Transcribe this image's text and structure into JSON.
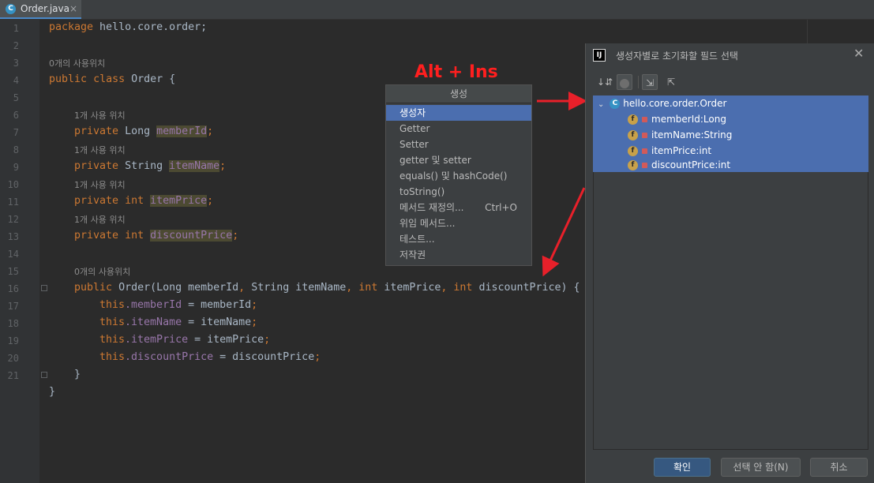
{
  "tab": {
    "file_name": "Order.java",
    "close": "×",
    "icon_letter": "C"
  },
  "editor": {
    "line_numbers": [
      "1",
      "2",
      "3",
      "4",
      "5",
      "6",
      "7",
      "8",
      "9",
      "10",
      "11",
      "12",
      "13",
      "14",
      "15",
      "16",
      "17",
      "18",
      "19",
      "20",
      "21"
    ],
    "line1": {
      "kw": "package",
      "rest": " hello.core.order;"
    },
    "hint_class": "0개의 사용위치",
    "line3": {
      "kw1": "public",
      "kw2": "class",
      "name": "Order",
      "brace": " {"
    },
    "hint_member": "1개 사용 위치",
    "fields": [
      {
        "kw": "private",
        "type": "Long",
        "name": "memberId"
      },
      {
        "kw": "private",
        "type": "String",
        "name": "itemName"
      },
      {
        "kw": "private",
        "type": "int",
        "name": "itemPrice"
      },
      {
        "kw": "private",
        "type": "int",
        "name": "discountPrice"
      }
    ],
    "hint_ctor": "0개의 사용위치",
    "ctor": {
      "kw": "public",
      "name": "Order",
      "p1": "(Long memberId",
      "c1": ",",
      "p2": " String itemName",
      "c2": ",",
      "t3": " int",
      "p3": " itemPrice",
      "c3": ",",
      "t4": " int",
      "p4": " discountPrice) {"
    },
    "assignments": [
      {
        "this": "this",
        "field": ".memberId",
        "rest": " = memberId",
        "semi": ";"
      },
      {
        "this": "this",
        "field": ".itemName",
        "rest": " = itemName",
        "semi": ";"
      },
      {
        "this": "this",
        "field": ".itemPrice",
        "rest": " = itemPrice",
        "semi": ";"
      },
      {
        "this": "this",
        "field": ".discountPrice",
        "rest": " = discountPrice",
        "semi": ";"
      }
    ],
    "close_inner": "}",
    "close_outer": "}",
    "semi": ";"
  },
  "annotation": "Alt + Ins",
  "generate_popup": {
    "title": "생성",
    "items": [
      {
        "label": "생성자",
        "shortcut": ""
      },
      {
        "label": "Getter",
        "shortcut": ""
      },
      {
        "label": "Setter",
        "shortcut": ""
      },
      {
        "label": "getter 및 setter",
        "shortcut": ""
      },
      {
        "label": "equals() 및 hashCode()",
        "shortcut": ""
      },
      {
        "label": "toString()",
        "shortcut": ""
      },
      {
        "label": "메서드 재정의...",
        "shortcut": "Ctrl+O"
      },
      {
        "label": "위임 메서드...",
        "shortcut": ""
      },
      {
        "label": "테스트...",
        "shortcut": ""
      },
      {
        "label": "저작권",
        "shortcut": ""
      }
    ]
  },
  "dialog": {
    "title": "생성자별로 초기화할 필드 선택",
    "app_icon_text": "IJ",
    "close": "✕",
    "toolbar": {
      "sort": "↓⇵",
      "expand": "⇲",
      "collapse": "⇱"
    },
    "tree": {
      "root": "hello.core.order.Order",
      "root_icon": "C",
      "field_icon": "f",
      "fields": [
        "memberId:Long",
        "itemName:String",
        "itemPrice:int",
        "discountPrice:int"
      ]
    },
    "buttons": {
      "ok": "확인",
      "select_none": "선택 안 함(N)",
      "cancel": "취소"
    }
  },
  "colors": {
    "arrow": "#e8202a",
    "selection": "#4b6eaf",
    "keyword": "#cc7832",
    "field": "#9876aa"
  }
}
